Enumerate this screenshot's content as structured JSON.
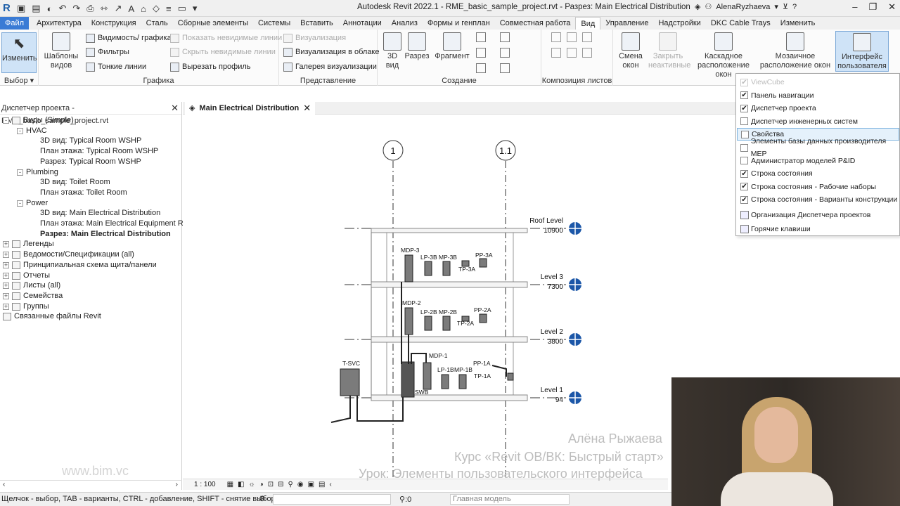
{
  "titlebar": {
    "app_logo": "R",
    "title": "Autodesk Revit 2022.1 - RME_basic_sample_project.rvt - Разрез: Main Electrical Distribution",
    "user": "AlenaRyzhaeva"
  },
  "tabs": [
    "Файл",
    "Архитектура",
    "Конструкция",
    "Сталь",
    "Сборные элементы",
    "Системы",
    "Вставить",
    "Аннотации",
    "Анализ",
    "Формы и генплан",
    "Совместная работа",
    "Вид",
    "Управление",
    "Надстройки",
    "DKC Cable Trays",
    "Изменить"
  ],
  "ribbon": {
    "select": {
      "button": "Изменить",
      "label": "Выбор"
    },
    "graphics": {
      "templates": "Шаблоны видов",
      "visibility": "Видимость/ графика",
      "filters": "Фильтры",
      "thin_lines": "Тонкие линии",
      "show_hidden": "Показать невидимые линии",
      "hide_hidden": "Скрыть невидимые линии",
      "cut_profile": "Вырезать профиль",
      "label": "Графика"
    },
    "presentation": {
      "render": "Визуализация",
      "cloud_render": "Визуализация  в облаке",
      "gallery": "Галерея  визуализации",
      "label": "Представление"
    },
    "create": {
      "view3d": "3D вид",
      "section": "Разрез",
      "callout": "Фрагмент",
      "label": "Создание"
    },
    "sheet": {
      "label": "Композиция листов"
    },
    "windows": {
      "switch": "Смена окон",
      "close_inactive": "Закрыть неактивные",
      "cascade": "Каскадное расположение окон",
      "tile": "Мозаичное расположение окон",
      "ui": "Интерфейс пользователя"
    }
  },
  "browser": {
    "title": "Диспетчер проекта - RME_basic_sample_project.rvt",
    "items": [
      {
        "label": "Виды (Simple)",
        "level": 0,
        "exp": "-"
      },
      {
        "label": "HVAC",
        "level": 1,
        "exp": "-"
      },
      {
        "label": "3D вид: Typical Room WSHP",
        "level": 2
      },
      {
        "label": "План этажа: Typical Room WSHP",
        "level": 2
      },
      {
        "label": "Разрез: Typical Room WSHP",
        "level": 2
      },
      {
        "label": "Plumbing",
        "level": 1,
        "exp": "-"
      },
      {
        "label": "3D вид: Toilet Room",
        "level": 2
      },
      {
        "label": "План этажа: Toilet Room",
        "level": 2
      },
      {
        "label": "Power",
        "level": 1,
        "exp": "-"
      },
      {
        "label": "3D вид: Main Electrical Distribution",
        "level": 2
      },
      {
        "label": "План этажа: Main Electrical Equipment Room",
        "level": 2
      },
      {
        "label": "Разрез: Main Electrical Distribution",
        "level": 2,
        "bold": true
      },
      {
        "label": "Легенды",
        "level": 0,
        "exp": "+"
      },
      {
        "label": "Ведомости/Спецификации (all)",
        "level": 0,
        "exp": "+"
      },
      {
        "label": "Принципиальная схема щита/панели",
        "level": 0,
        "exp": "+"
      },
      {
        "label": "Отчеты",
        "level": 0,
        "exp": "+"
      },
      {
        "label": "Листы (all)",
        "level": 0,
        "exp": "+"
      },
      {
        "label": "Семейства",
        "level": 0,
        "exp": "+"
      },
      {
        "label": "Группы",
        "level": 0,
        "exp": "+"
      },
      {
        "label": "Связанные файлы Revit",
        "level": 0
      }
    ],
    "watermark": "www.bim.vc"
  },
  "view_tab": {
    "label": "Main Electrical Distribution"
  },
  "drawing": {
    "grids": [
      "1",
      "1.1"
    ],
    "levels": [
      {
        "name": "Roof Level",
        "elev": "10900"
      },
      {
        "name": "Level 3",
        "elev": "7300"
      },
      {
        "name": "Level 2",
        "elev": "3800"
      },
      {
        "name": "Level 1",
        "elev": "94"
      }
    ],
    "equipment": [
      "MDP-3",
      "LP-3B",
      "MP-3B",
      "PP-3A",
      "TP-3A",
      "MDP-2",
      "LP-2B",
      "MP-2B",
      "PP-2A",
      "TP-2A",
      "MDP-1",
      "LP-1B",
      "MP-1B",
      "PP-1A",
      "TP-1A",
      "T-SVC",
      "SWB"
    ]
  },
  "view_control": {
    "scale": "1 : 100"
  },
  "status": {
    "text": "Щелчок - выбор, TAB - варианты, CTRL - добавление, SHIFT - снятие выбора.",
    "counter": ":0",
    "model": "Главная модель"
  },
  "dropdown": {
    "items": [
      {
        "label": "ViewCube",
        "checked": true,
        "disabled": true
      },
      {
        "label": "Панель навигации",
        "checked": true
      },
      {
        "label": "Диспетчер проекта",
        "checked": true
      },
      {
        "label": "Диспетчер инженерных систем",
        "checked": false
      },
      {
        "label": "Свойства",
        "checked": false,
        "hover": true
      },
      {
        "label": "Элементы базы данных производителя MEP",
        "checked": false
      },
      {
        "label": "Администратор моделей P&ID",
        "checked": false
      },
      {
        "label": "Строка состояния",
        "checked": true
      },
      {
        "label": "Строка состояния - Рабочие наборы",
        "checked": true
      },
      {
        "label": "Строка состояния - Варианты конструкции",
        "checked": true
      }
    ],
    "menu_items": [
      "Организация Диспетчера проектов",
      "Горячие клавиши"
    ]
  },
  "overlay": {
    "author": "Алёна Рыжаева",
    "course": "Курс «Revit ОВ/ВК: Быстрый старт»",
    "lesson": "Урок: Элементы пользовательского интерфейса"
  }
}
